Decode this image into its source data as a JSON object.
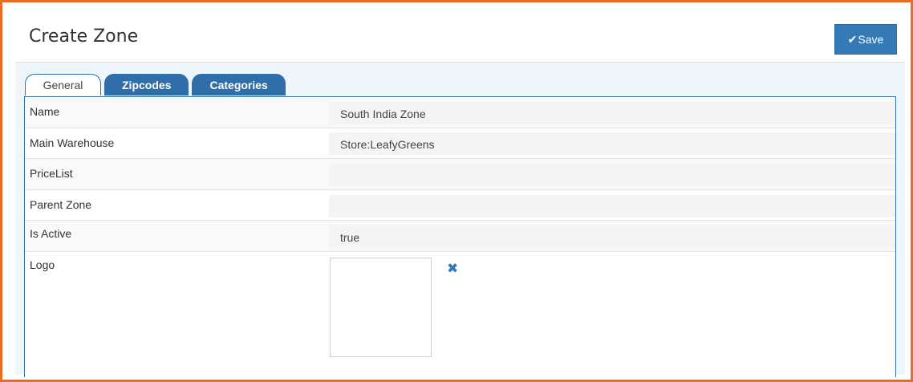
{
  "header": {
    "title": "Create Zone",
    "save_label": "Save",
    "save_icon": "check-icon"
  },
  "tabs": [
    {
      "label": "General",
      "active": true
    },
    {
      "label": "Zipcodes",
      "active": false
    },
    {
      "label": "Categories",
      "active": false
    }
  ],
  "form": {
    "rows": [
      {
        "label": "Name",
        "value": "South India Zone"
      },
      {
        "label": "Main Warehouse",
        "value": "Store:LeafyGreens"
      },
      {
        "label": "PriceList",
        "value": ""
      },
      {
        "label": "Parent Zone",
        "value": ""
      },
      {
        "label": "Is Active",
        "value": "true"
      }
    ],
    "logo": {
      "label": "Logo",
      "remove_icon": "close-icon"
    }
  },
  "colors": {
    "frame_border": "#ec6b22",
    "primary": "#337ab7",
    "tab_bar_bg": "#eef5fb"
  }
}
